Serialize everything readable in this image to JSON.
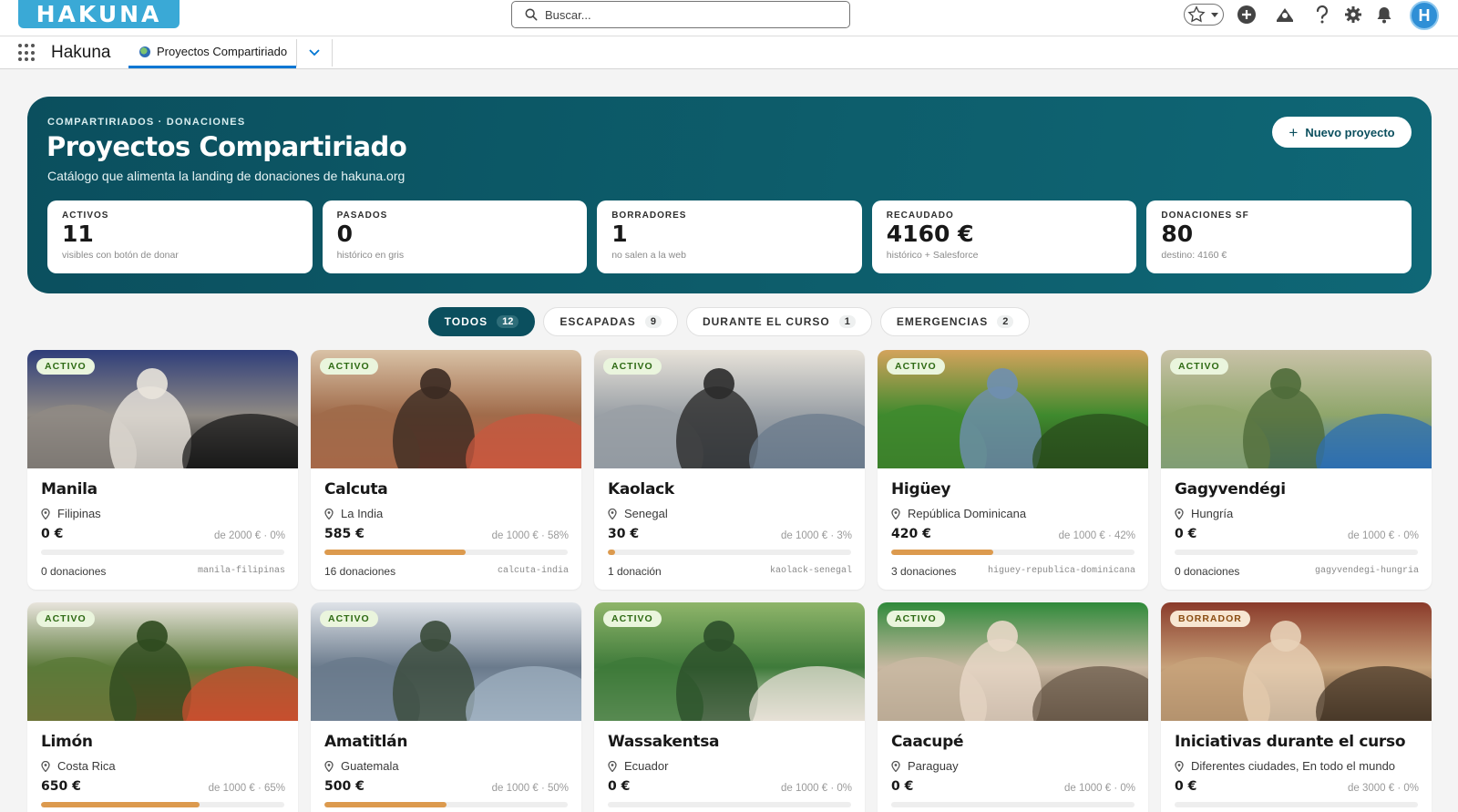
{
  "header": {
    "logo_text": "HAKUNA",
    "search_placeholder": "Buscar...",
    "avatar_initial": "H"
  },
  "nav": {
    "app_name": "Hakuna",
    "tab_label": "Proyectos Compartiriado"
  },
  "hero": {
    "eyebrow": "COMPARTIRIADOS · DONACIONES",
    "title": "Proyectos Compartiriado",
    "subtitle": "Catálogo que alimenta la landing de donaciones de hakuna.org",
    "new_button": "Nuevo proyecto",
    "stats": [
      {
        "label": "ACTIVOS",
        "value": "11",
        "note": "visibles con botón de donar"
      },
      {
        "label": "PASADOS",
        "value": "0",
        "note": "histórico en gris"
      },
      {
        "label": "BORRADORES",
        "value": "1",
        "note": "no salen a la web"
      },
      {
        "label": "RECAUDADO",
        "value": "4160 €",
        "note": "histórico + Salesforce"
      },
      {
        "label": "DONACIONES SF",
        "value": "80",
        "note": "destino: 4160 €"
      }
    ]
  },
  "filters": [
    {
      "label": "TODOS",
      "count": "12",
      "active": true
    },
    {
      "label": "ESCAPADAS",
      "count": "9",
      "active": false
    },
    {
      "label": "DURANTE EL CURSO",
      "count": "1",
      "active": false
    },
    {
      "label": "EMERGENCIAS",
      "count": "2",
      "active": false
    }
  ],
  "colors": {
    "hero_bg": "#0b4f5e",
    "progress": "#dc9a4e",
    "active_badge_bg": "#eaf5dd",
    "draft_badge_bg": "#f7e6d2"
  },
  "projects": [
    {
      "status": "ACTIVO",
      "title": "Manila",
      "location": "Filipinas",
      "raised": "0 €",
      "goal": "de 2000 € · 0%",
      "progress": 0,
      "donations": "0 donaciones",
      "slug": "manila-filipinas"
    },
    {
      "status": "ACTIVO",
      "title": "Calcuta",
      "location": "La India",
      "raised": "585 €",
      "goal": "de 1000 € · 58%",
      "progress": 58,
      "donations": "16 donaciones",
      "slug": "calcuta-india"
    },
    {
      "status": "ACTIVO",
      "title": "Kaolack",
      "location": "Senegal",
      "raised": "30 €",
      "goal": "de 1000 € · 3%",
      "progress": 3,
      "donations": "1 donación",
      "slug": "kaolack-senegal"
    },
    {
      "status": "ACTIVO",
      "title": "Higüey",
      "location": "República Dominicana",
      "raised": "420 €",
      "goal": "de 1000 € · 42%",
      "progress": 42,
      "donations": "3 donaciones",
      "slug": "higuey-republica-dominicana"
    },
    {
      "status": "ACTIVO",
      "title": "Gagyvendégi",
      "location": "Hungría",
      "raised": "0 €",
      "goal": "de 1000 € · 0%",
      "progress": 0,
      "donations": "0 donaciones",
      "slug": "gagyvendegi-hungria"
    },
    {
      "status": "ACTIVO",
      "title": "Limón",
      "location": "Costa Rica",
      "raised": "650 €",
      "goal": "de 1000 € · 65%",
      "progress": 65,
      "donations": "",
      "slug": ""
    },
    {
      "status": "ACTIVO",
      "title": "Amatitlán",
      "location": "Guatemala",
      "raised": "500 €",
      "goal": "de 1000 € · 50%",
      "progress": 50,
      "donations": "",
      "slug": ""
    },
    {
      "status": "ACTIVO",
      "title": "Wassakentsa",
      "location": "Ecuador",
      "raised": "0 €",
      "goal": "de 1000 € · 0%",
      "progress": 0,
      "donations": "",
      "slug": ""
    },
    {
      "status": "ACTIVO",
      "title": "Caacupé",
      "location": "Paraguay",
      "raised": "0 €",
      "goal": "de 1000 € · 0%",
      "progress": 0,
      "donations": "",
      "slug": ""
    },
    {
      "status": "BORRADOR",
      "title": "Iniciativas durante el curso",
      "location": "Diferentes ciudades, En todo el mundo",
      "raised": "0 €",
      "goal": "de 3000 € · 0%",
      "progress": 0,
      "donations": "",
      "slug": ""
    }
  ]
}
